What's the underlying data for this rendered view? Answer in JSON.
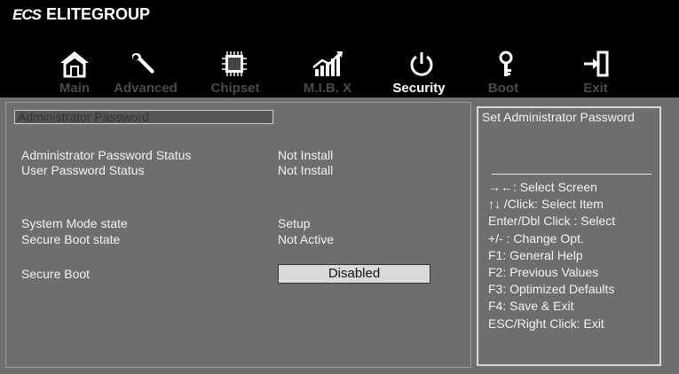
{
  "brand": {
    "logo": "ECS",
    "name": "ELITEGROUP"
  },
  "tabs": [
    {
      "label": "Main",
      "icon": "home-icon"
    },
    {
      "label": "Advanced",
      "icon": "wrench-icon"
    },
    {
      "label": "Chipset",
      "icon": "chip-icon"
    },
    {
      "label": "M.I.B. X",
      "icon": "performance-graph-icon"
    },
    {
      "label": "Security",
      "icon": "power-icon",
      "active": true
    },
    {
      "label": "Boot",
      "icon": "key-icon"
    },
    {
      "label": "Exit",
      "icon": "exit-icon"
    }
  ],
  "settings": {
    "selected_item": "Administrator  Password",
    "admin_status_label": "Administrator Password Status",
    "admin_status_value": "Not Install",
    "user_status_label": "User Password Status",
    "user_status_value": "Not Install",
    "system_mode_label": "System Mode state",
    "system_mode_value": "Setup",
    "secure_boot_state_label": "Secure Boot state",
    "secure_boot_state_value": "Not Active",
    "secure_boot_label": "Secure Boot",
    "secure_boot_value": "Disabled"
  },
  "help": {
    "title": "Set Administrator Password",
    "lines": [
      "→←: Select Screen",
      "↑↓ /Click: Select Item",
      "Enter/Dbl Click : Select",
      "+/- : Change Opt.",
      "F1: General Help",
      "F2: Previous Values",
      "F3: Optimized Defaults",
      "F4: Save & Exit",
      "ESC/Right Click: Exit"
    ]
  },
  "colors": {
    "background": "#6e6e6e",
    "header": "#000000",
    "text": "#f2f2f2",
    "inactive_tab": "#4a4a4a",
    "active_tab": "#ffffff"
  }
}
